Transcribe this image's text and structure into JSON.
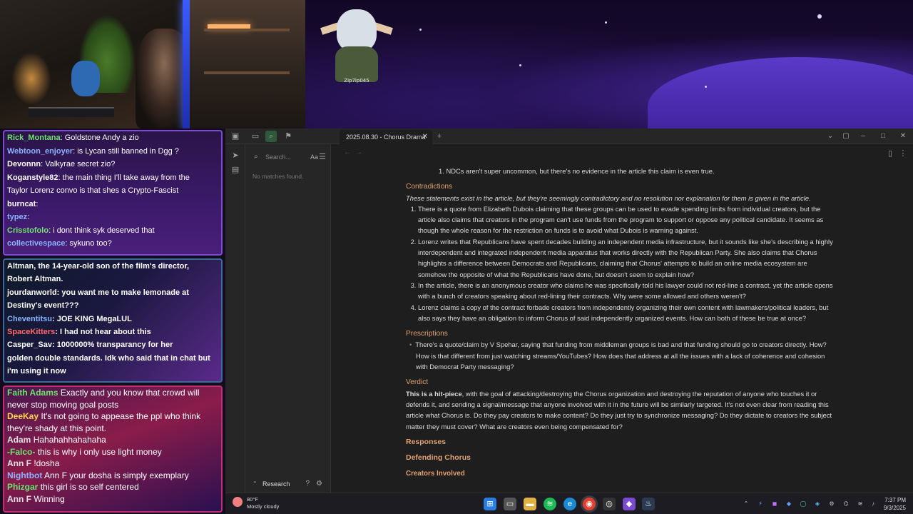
{
  "stream": {
    "overlay_name": "Zip7ip045"
  },
  "chat_box1": [
    {
      "user": "Rick_Montana",
      "color": "#6fe36f",
      "text": "Goldstone Andy a zio"
    },
    {
      "user": "Webtoon_enjoyer",
      "color": "#8ab4ff",
      "text": "is Lycan still banned in Dgg ?"
    },
    {
      "user": "Devonnn",
      "color": "#ffffff",
      "text": "Valkyrae secret zio?"
    },
    {
      "user": "Koganstyle82",
      "color": "#ffffff",
      "text": "the main thing I'll take away from the"
    },
    {
      "user": "",
      "color": "#ffffff",
      "text": "Taylor Lorenz convo is that shes a Crypto-Fascist"
    },
    {
      "user": "burncat",
      "color": "#ffffff",
      "text": ""
    },
    {
      "user": "typez",
      "color": "#8ab4ff",
      "text": ""
    },
    {
      "user": "Crisstofolo",
      "color": "#6fe36f",
      "text": "i dont think syk deserved that"
    },
    {
      "user": "collectivespace",
      "color": "#8ab4ff",
      "text": "sykuno too?"
    }
  ],
  "chat_box2": [
    {
      "user": "",
      "color": "#ffffff",
      "text": "Altman, the 14-year-old son of the film's director,"
    },
    {
      "user": "",
      "color": "#ffffff",
      "text": "Robert Altman."
    },
    {
      "user": "jourdanworld",
      "color": "#ffffff",
      "text": "you want me to make lemonade at"
    },
    {
      "user": "",
      "color": "#ffffff",
      "text": "Destiny's event???"
    },
    {
      "user": "Cheventitsu",
      "color": "#8ab4ff",
      "text": "JOE KING MegaLUL"
    },
    {
      "user": "SpaceKitters",
      "color": "#ff6a6a",
      "text": "I had not hear about this"
    },
    {
      "user": "Casper_Sav",
      "color": "#ffffff",
      "text": "1000000% transparancy for her"
    },
    {
      "user": "",
      "color": "#ffffff",
      "text": "golden double standards. Idk who said that in chat but"
    },
    {
      "user": "",
      "color": "#ffffff",
      "text": "i'm using it now"
    }
  ],
  "chat_box3": [
    {
      "user": "Faith Adams",
      "color": "#6fe36f",
      "text": "Exactly and you know that crowd will never stop moving goal posts"
    },
    {
      "user": "DeeKay",
      "color": "#ffd54a",
      "text": "It's not going to appease the ppl who think they're shady at this point."
    },
    {
      "user": "Adam",
      "color": "#e0e0e0",
      "text": "Hahahahhahahaha"
    },
    {
      "user": "-Falco-",
      "color": "#6fe36f",
      "text": "this is why i only use light money"
    },
    {
      "user": "Ann F",
      "color": "#e0e0e0",
      "text": "!dosha"
    },
    {
      "user": "Nightbot",
      "color": "#8ab4ff",
      "text": "Ann F your dosha is simply exemplary"
    },
    {
      "user": "Phizgar",
      "color": "#6fe36f",
      "text": "this girl is so self centered"
    },
    {
      "user": "Ann F",
      "color": "#e0e0e0",
      "text": "Winning"
    }
  ],
  "app": {
    "tab_title": "2025.08.30 - Chorus Drama",
    "search_placeholder": "Search...",
    "search_case": "Aa",
    "no_matches": "No matches found.",
    "research_label": "Research"
  },
  "doc": {
    "top_item": "NDCs aren't super uncommon, but there's no evidence in the article this claim is even true.",
    "top_item_num": "1.",
    "contradictions_title": "Contradictions",
    "contradictions_intro": "These statements exist in the article, but they're seemingly contradictory and no resolution nor explanation for them is given in the article.",
    "contradictions": [
      "There is a quote from Elizabeth Dubois claiming that these groups can be used to evade spending limits from individual creators, but the article also claims that creators in the program can't use funds from the program to support or oppose any political candidate. It seems as though the whole reason for the restriction on funds is to avoid what Dubois is warning against.",
      "Lorenz writes that Republicans have spent decades building an independent media infrastructure, but it sounds like she's describing a highly interdependent and integrated independent media apparatus that works directly with the Republican Party. She also claims that Chorus highlights a difference between Democrats and Republicans, claiming that Chorus' attempts to build an online media ecosystem are somehow the opposite of what the Republicans have done, but doesn't seem to explain how?",
      "In the article, there is an anonymous creator who claims he was specifically told his lawyer could not red-line a contract, yet the article opens with a bunch of creators speaking about red-lining their contracts. Why were some allowed and others weren't?",
      "Lorenz claims a copy of the contract forbade creators from independently organizing their own content with lawmakers/political leaders, but also says they have an obligation to inform Chorus of said independently organized events. How can both of these be true at once?"
    ],
    "prescriptions_title": "Prescriptions",
    "prescriptions": [
      "There's a quote/claim by V Spehar, saying that funding from middleman groups is bad and that funding should go to creators directly. How? How is that different from just watching streams/YouTubes? How does that address at all the issues with a lack of coherence and cohesion with Democrat Party messaging?"
    ],
    "verdict_title": "Verdict",
    "verdict_bold": "This is a hit-piece",
    "verdict_text": ", with the goal of attacking/destroying the Chorus organization and destroying the reputation of anyone who touches it or defends it, and sending a signal/message that anyone involved with it in the future will be similarly targeted. It's not even clear from reading this article what Chorus is. Do they pay creators to make content? Do they just try to synchronize messaging? Do they dictate to creators the subject matter they must cover? What are creators even being compensated for?",
    "responses_title": "Responses",
    "defending_title": "Defending Chorus",
    "creators_title": "Creators Involved"
  },
  "taskbar": {
    "temp": "80°F",
    "weather": "Mostly cloudy",
    "time": "7:37 PM",
    "date": "9/3/2025"
  },
  "colors": {
    "heading": "#e0a070",
    "text": "#dcddde",
    "app_bg": "#1e1e1e"
  }
}
